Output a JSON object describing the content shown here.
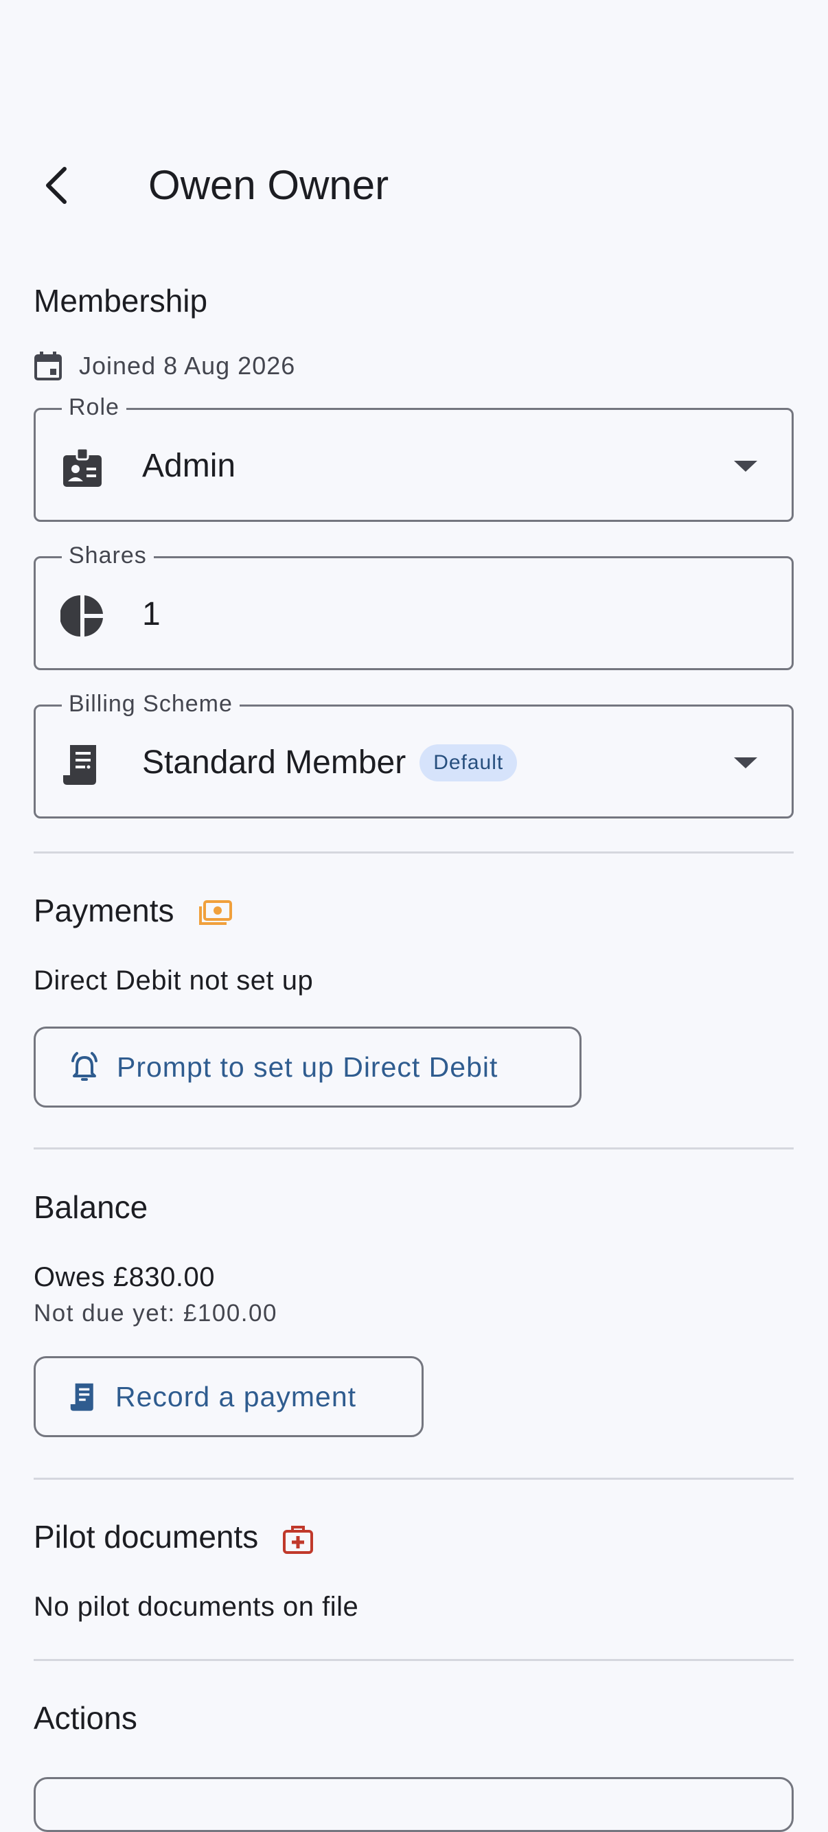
{
  "header": {
    "title": "Owen Owner"
  },
  "membership": {
    "section_title": "Membership",
    "joined_text": "Joined 8 Aug 2026",
    "role": {
      "label": "Role",
      "value": "Admin"
    },
    "shares": {
      "label": "Shares",
      "value": "1"
    },
    "billing": {
      "label": "Billing Scheme",
      "value": "Standard Member",
      "badge": "Default"
    }
  },
  "payments": {
    "section_title": "Payments",
    "status_text": "Direct Debit not set up",
    "prompt_button": "Prompt to set up Direct Debit"
  },
  "balance": {
    "section_title": "Balance",
    "owes_text": "Owes £830.00",
    "not_due_text": "Not due yet: £100.00",
    "record_button": "Record a payment"
  },
  "pilot_documents": {
    "section_title": "Pilot documents",
    "empty_text": "No pilot documents on file"
  },
  "actions": {
    "section_title": "Actions"
  },
  "colors": {
    "background": "#f7f8fc",
    "accent_text": "#2f5c8f",
    "payments_icon": "#f0a03c",
    "pilot_icon": "#c0392b",
    "badge_bg": "#d6e3fb"
  },
  "icons": {
    "back": "arrow-back-icon",
    "calendar": "calendar-icon",
    "role": "badge-icon",
    "shares": "pie-chart-icon",
    "billing": "receipt-icon",
    "payments": "payments-icon",
    "alarm": "alarm-bell-icon",
    "record": "receipt-icon",
    "pilot": "medical-bag-icon"
  }
}
